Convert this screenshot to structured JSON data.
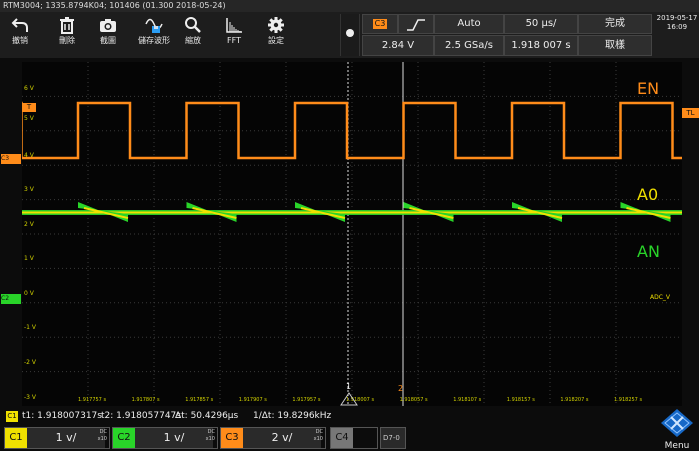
{
  "title": "RTM3004; 1335.8794K04; 101406 (01.300 2018-05-24)",
  "toolbar": [
    {
      "label": "撤销",
      "icon": "undo-icon"
    },
    {
      "label": "刪除",
      "icon": "trash-icon"
    },
    {
      "label": "截圖",
      "icon": "camera-icon"
    },
    {
      "label": "儲存波形",
      "icon": "save-waveform-icon"
    },
    {
      "label": "縮放",
      "icon": "zoom-icon"
    },
    {
      "label": "FFT",
      "icon": "fft-icon"
    },
    {
      "label": "設定",
      "icon": "gear-icon"
    }
  ],
  "trigger": {
    "source": "C3",
    "slope": "rising-edge",
    "mode": "Auto",
    "timebase": "50 µs/",
    "status": "完成",
    "level": "2.84 V",
    "samplerate": "2.5 GSa/s",
    "position": "1.918 007 s",
    "acquire": "取樣"
  },
  "datetime": {
    "date": "2019-05-17",
    "time": "16:09"
  },
  "markers": {
    "trigger_left": "T",
    "trigger_right": "TL",
    "cursor2": "2",
    "cursor1": "1",
    "c3_marker": "C3",
    "c2_marker": "C2"
  },
  "volt_labels": [
    "6 V",
    "5 V",
    "4 V",
    "3 V",
    "2 V",
    "1 V",
    "0 V",
    "-1 V",
    "-2 V",
    "-3 V"
  ],
  "time_labels": [
    "1.917757 s",
    "1.917807 s",
    "1.917857 s",
    "1.917907 s",
    "1.917957 s",
    "1.918007 s",
    "1.918057 s",
    "1.918107 s",
    "1.918157 s",
    "1.918207 s",
    "1.918257 s"
  ],
  "trace_labels": {
    "en": "EN",
    "a0": "A0",
    "an": "AN",
    "adc": "ADC_V"
  },
  "colors": {
    "orange": "#ff8c1a",
    "yellow": "#f0e000",
    "green": "#29d429",
    "grid": "#3a3a3a"
  },
  "status_bar": {
    "cursor_tag": "C1",
    "t1": "t1: 1.918007317s",
    "t2": "t2: 1.918057747s",
    "dt": "Δt: 50.4296µs",
    "inv_dt": "1/Δt: 19.8296kHz"
  },
  "channels": [
    {
      "id": "C1",
      "scale": "1 v/",
      "coupling": "DC",
      "probe": "x10",
      "color": "#f0e000"
    },
    {
      "id": "C2",
      "scale": "1 v/",
      "coupling": "DC",
      "probe": "x10",
      "color": "#29d429"
    },
    {
      "id": "C3",
      "scale": "2 v/",
      "coupling": "DC",
      "probe": "x10",
      "color": "#ff8c1a"
    },
    {
      "id": "C4",
      "scale": "",
      "coupling": "",
      "probe": "",
      "color": "#777777"
    },
    {
      "id": "D7-0",
      "scale": "",
      "coupling": "",
      "probe": "",
      "color": "#777777"
    }
  ],
  "menu_label": "Menu"
}
